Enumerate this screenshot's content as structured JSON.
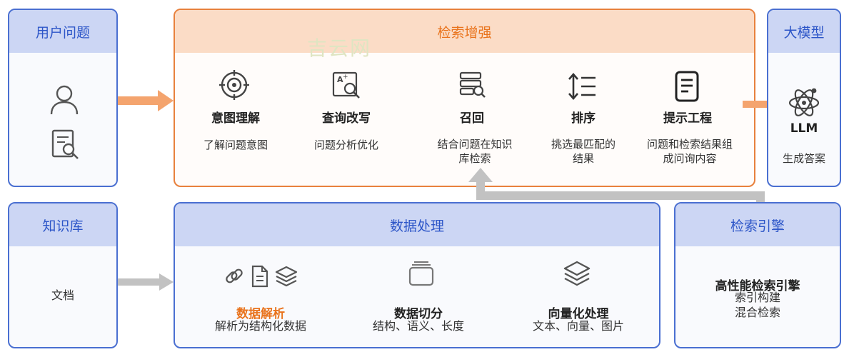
{
  "user_question": {
    "title": "用户问题"
  },
  "retrieval": {
    "title": "检索增强",
    "steps": [
      {
        "title": "意图理解",
        "desc1": "了解问题意图",
        "desc2": ""
      },
      {
        "title": "查询改写",
        "desc1": "问题分析优化",
        "desc2": ""
      },
      {
        "title": "召回",
        "desc1": "结合问题在知识",
        "desc2": "库检索"
      },
      {
        "title": "排序",
        "desc1": "挑选最匹配的",
        "desc2": "结果"
      },
      {
        "title": "提示工程",
        "desc1": "问题和检索结果组",
        "desc2": "成问询内容"
      }
    ]
  },
  "watermark": "吉云网",
  "llm": {
    "title": "大模型",
    "name": "LLM",
    "desc": "生成答案"
  },
  "knowledge": {
    "title": "知识库",
    "doc": "文档"
  },
  "data_processing": {
    "title": "数据处理",
    "items": [
      {
        "title": "数据解析",
        "desc": "解析为结构化数据"
      },
      {
        "title": "数据切分",
        "desc": "结构、语义、长度"
      },
      {
        "title": "向量化处理",
        "desc": "文本、向量、图片"
      }
    ]
  },
  "engine": {
    "title": "检索引擎",
    "line1": "高性能检索引擎",
    "line2": "索引构建",
    "line3": "混合检索"
  },
  "colors": {
    "blue": "#4a6fd1",
    "orange": "#e9731c",
    "gray_arrow": "#bfbfbf",
    "orange_arrow": "#f4a46e"
  }
}
